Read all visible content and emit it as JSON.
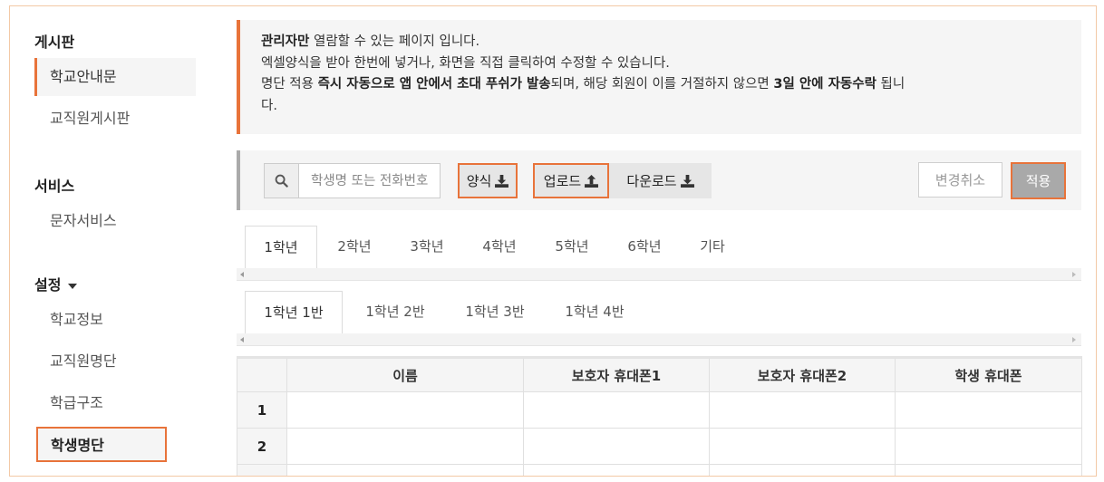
{
  "sidebar": {
    "board_title": "게시판",
    "board_items": [
      "학교안내문",
      "교직원게시판"
    ],
    "service_title": "서비스",
    "service_items": [
      "문자서비스"
    ],
    "settings_title": "설정",
    "settings_items": [
      "학교정보",
      "교직원명단",
      "학급구조",
      "학생명단"
    ]
  },
  "notice": {
    "line1_bold": "관리자만",
    "line1_rest": " 열람할 수 있는 페이지 입니다.",
    "line2": "엑셀양식을 받아 한번에 넣거나, 화면을 직접 클릭하여 수정할 수 있습니다.",
    "line3_a": "명단 적용 ",
    "line3_b_bold": "즉시 자동으로 앱 안에서 초대 푸쉬가 발송",
    "line3_c": "되며, 해당 회원이 이를 거절하지 않으면 ",
    "line3_d_bold": "3일 안에 자동수락",
    "line3_e": " 됩니",
    "line4": "다."
  },
  "toolbar": {
    "search_placeholder": "학생명 또는 전화번호",
    "form_button": "양식",
    "upload_button": "업로드",
    "download_button": "다운로드",
    "cancel_button": "변경취소",
    "apply_button": "적용"
  },
  "grade_tabs": [
    "1학년",
    "2학년",
    "3학년",
    "4학년",
    "5학년",
    "6학년",
    "기타"
  ],
  "class_tabs": [
    "1학년 1반",
    "1학년 2반",
    "1학년 3반",
    "1학년 4반"
  ],
  "table": {
    "headers": [
      "",
      "이름",
      "보호자 휴대폰1",
      "보호자 휴대폰2",
      "학생 휴대폰"
    ],
    "row_numbers": [
      "1",
      "2"
    ]
  },
  "colors": {
    "accent": "#e8733a",
    "panel": "#f5f5f5",
    "apply": "#a9a9a9"
  }
}
